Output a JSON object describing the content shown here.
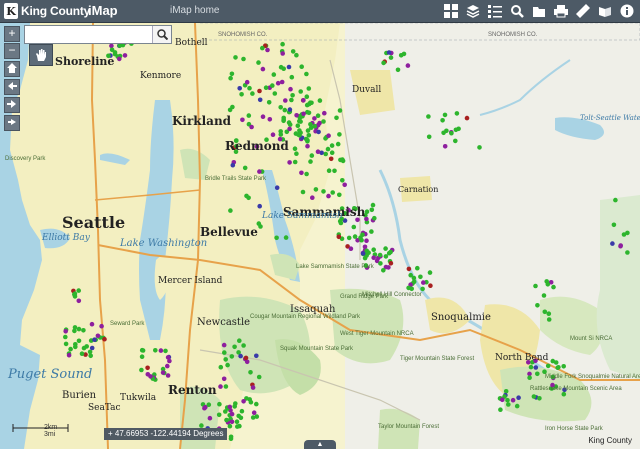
{
  "header": {
    "logo_text": "King County",
    "app_title": "iMap",
    "home_link": "iMap home",
    "tools": [
      "layout-icon",
      "layers-icon",
      "legend-icon",
      "search-tool-icon",
      "folder-icon",
      "print-icon",
      "measure-icon",
      "book-icon",
      "info-icon"
    ]
  },
  "search": {
    "placeholder": "",
    "value": ""
  },
  "nav": {
    "zoom_in": "+",
    "zoom_out": "−"
  },
  "status": {
    "coordinates": "47.66953 -122.44194 Degrees",
    "attribution": "King County",
    "scale_top": "2km",
    "scale_bottom": "3mi"
  },
  "map_labels": {
    "cities": [
      "Shoreline",
      "Kenmore",
      "Bothell",
      "Kirkland",
      "Redmond",
      "Duvall",
      "Seattle",
      "Bellevue",
      "Sammamish",
      "Mercer Island",
      "Newcastle",
      "Issaquah",
      "Renton",
      "Burien",
      "Tukwila",
      "SeaTac",
      "Snoqualmie",
      "North Bend",
      "Carnation"
    ],
    "water": [
      "Lake Washington",
      "Lake Sammamish",
      "Elliott Bay",
      "Puget Sound",
      "Tolt-Seattle Water Supply Reservoir"
    ],
    "parks": [
      "Lake Sammamish State Park",
      "Cougar Mountain Regional Wildland Park",
      "Squak Mountain State Park",
      "West Tiger Mountain NRCA",
      "Mitchell Hill Connector",
      "Grand Ridge Park",
      "Tiger Mountain State Forest",
      "Rattlesnake Mountain Scenic Area",
      "Middle Fork Snoqualmie Natural Area",
      "Mount Si NRCA",
      "Iron Horse State Park",
      "Taylor Mountain Forest",
      "Bridle Trails State Park",
      "Discovery Park",
      "Seward Park"
    ],
    "county_line": "SNOHOMISH CO."
  },
  "layers": {
    "green_color": "#2db52d",
    "purple_color": "#8e1f9e",
    "blue_color": "#3a3aa8",
    "red_color": "#a82020"
  }
}
